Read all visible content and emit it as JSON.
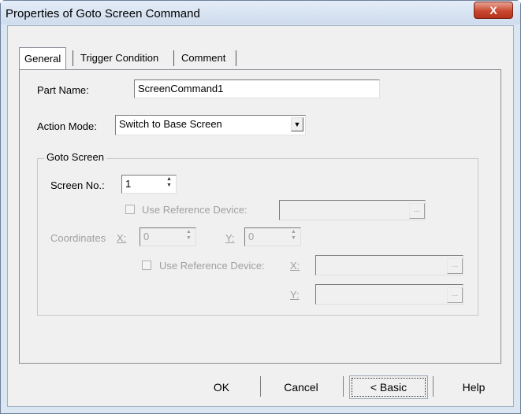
{
  "window": {
    "title": "Properties of Goto Screen Command",
    "close_label": "X"
  },
  "tabs": [
    {
      "label": "General",
      "active": true
    },
    {
      "label": "Trigger Condition",
      "active": false
    },
    {
      "label": "Comment",
      "active": false
    }
  ],
  "general": {
    "part_name_label": "Part Name:",
    "part_name_value": "ScreenCommand1",
    "action_mode_label": "Action Mode:",
    "action_mode_value": "Switch to Base Screen",
    "goto_screen": {
      "title": "Goto Screen",
      "screen_no_label": "Screen No.:",
      "screen_no_value": "1",
      "use_ref_device_label": "Use Reference Device:",
      "use_ref_device_value": "",
      "coordinates_label": "Coordinates",
      "x_label": "X:",
      "x_value": "0",
      "y_label": "Y:",
      "y_value": "0",
      "coord_ref_device_label": "Use Reference Device:",
      "coord_x_label": "X:",
      "coord_y_label": "Y:",
      "coord_x_device": "",
      "coord_y_device": "",
      "browse_label": "..."
    }
  },
  "buttons": {
    "ok": "OK",
    "cancel": "Cancel",
    "basic": "< Basic",
    "help": "Help"
  },
  "colors": {
    "title_bar": "#dbe6f3",
    "close_button": "#c9482f",
    "dialog_bg": "#f0f0f0",
    "disabled_text": "#a0a0a0"
  }
}
